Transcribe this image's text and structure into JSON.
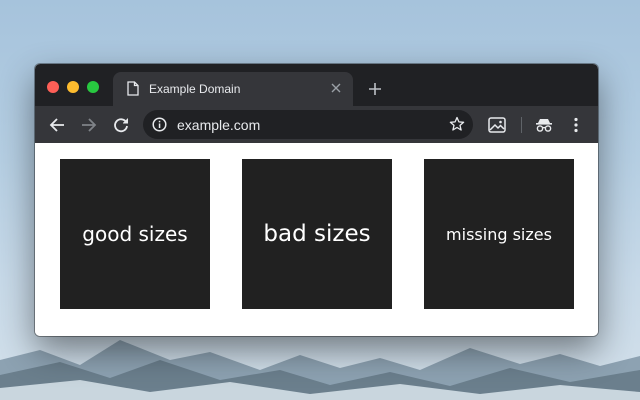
{
  "tab": {
    "title": "Example Domain",
    "icon": "document-icon"
  },
  "toolbar": {
    "back_icon": "arrow-left-icon",
    "forward_icon": "arrow-right-icon",
    "reload_icon": "reload-icon"
  },
  "omnibox": {
    "url": "example.com",
    "info_icon": "info-icon",
    "bookmark_icon": "star-icon"
  },
  "extensions": [
    "image-icon",
    "incognito-icon"
  ],
  "menu_icon": "kebab-menu-icon",
  "images": [
    {
      "label": "good sizes"
    },
    {
      "label": "bad sizes"
    },
    {
      "label": "missing sizes"
    }
  ],
  "colors": {
    "titlebar": "#202124",
    "toolbar": "#35363a",
    "tile": "#212121"
  }
}
